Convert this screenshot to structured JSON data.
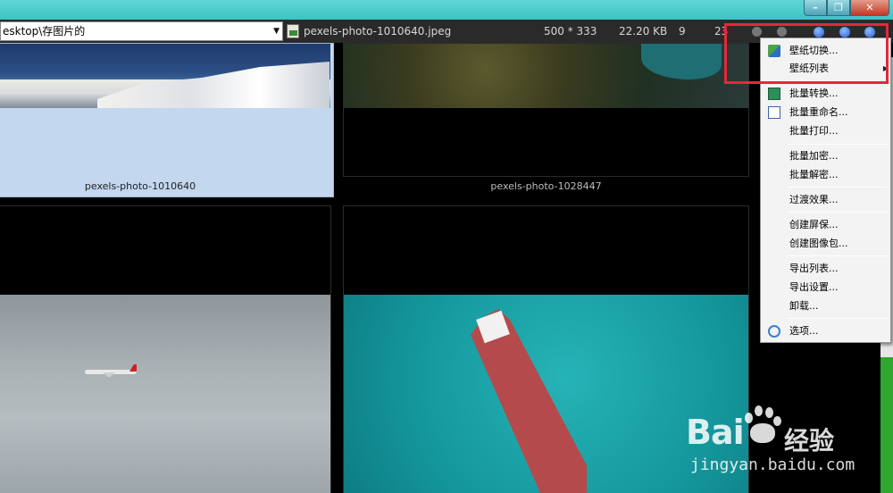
{
  "window": {
    "min_glyph": "–",
    "max_glyph": "❐",
    "close_glyph": "✕"
  },
  "toolbar": {
    "path": "esktop\\存图片的",
    "dropdown_arrow": "▼",
    "filename": "pexels-photo-1010640.jpeg",
    "dimensions": "500 * 333",
    "filesize": "22.20 KB",
    "count": "9",
    "extra": "23"
  },
  "thumbnails": [
    {
      "caption": "pexels-photo-1010640"
    },
    {
      "caption": "pexels-photo-1028447"
    }
  ],
  "context_menu": {
    "items": [
      {
        "label": "壁纸切换..."
      },
      {
        "label": "壁纸列表",
        "submenu": "▶"
      },
      {
        "label": "批量转换..."
      },
      {
        "label": "批量重命名..."
      },
      {
        "label": "批量打印..."
      },
      {
        "label": "批量加密..."
      },
      {
        "label": "批量解密..."
      },
      {
        "label": "过渡效果..."
      },
      {
        "label": "创建屏保..."
      },
      {
        "label": "创建图像包..."
      },
      {
        "label": "导出列表..."
      },
      {
        "label": "导出设置..."
      },
      {
        "label": "卸载..."
      },
      {
        "label": "选项..."
      }
    ]
  },
  "watermark": {
    "logo": "Bai",
    "logo_suffix": "经验",
    "url": "jingyan.baidu.com"
  },
  "colors": {
    "highlight": "#e3293a",
    "titlebar": "#3ec3c4",
    "selection": "#c3d7ef"
  }
}
